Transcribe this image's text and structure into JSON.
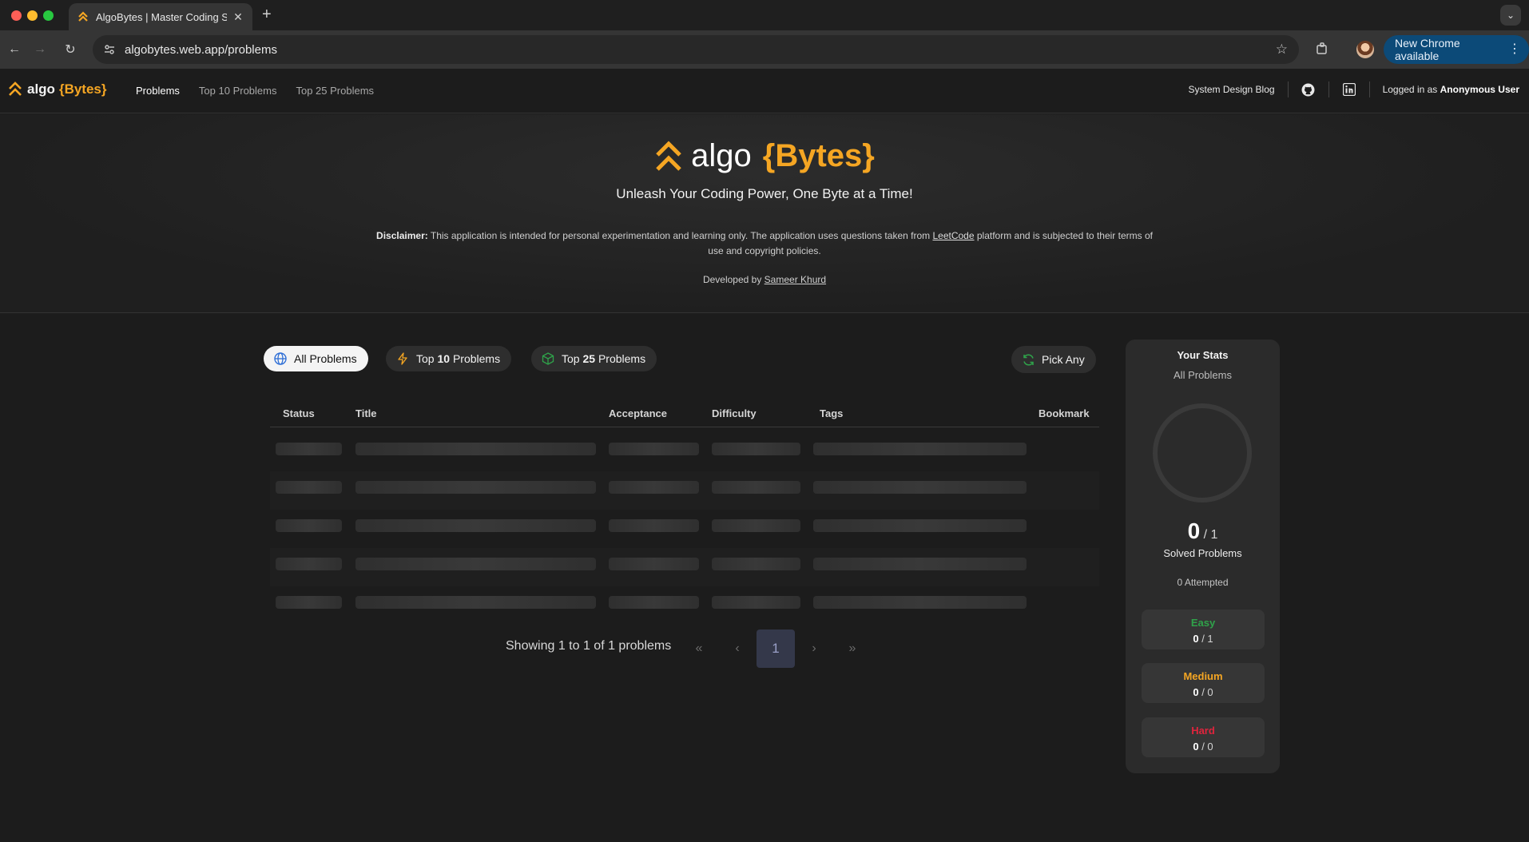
{
  "browser": {
    "tab_title": "AlgoBytes | Master Coding Sk",
    "url": "algobytes.web.app/problems",
    "update_label": "New Chrome available"
  },
  "nav": {
    "brand_text": "algo",
    "brand_accent": "{Bytes}",
    "links": [
      "Problems",
      "Top 10 Problems",
      "Top 25 Problems"
    ],
    "blog": "System Design Blog",
    "login_prefix": "Logged in as",
    "login_user": "Anonymous User"
  },
  "hero": {
    "logo_text": "algo",
    "logo_accent": "{Bytes}",
    "tagline": "Unleash Your Coding Power, One Byte at a Time!",
    "disclaimer_label": "Disclaimer:",
    "disclaimer_pre": "This application is intended for personal experimentation and learning only. The application uses questions taken from",
    "disclaimer_link": "LeetCode",
    "disclaimer_post": "platform and is subjected to their terms of use and copyright policies.",
    "dev_prefix": "Developed by",
    "dev_name": "Sameer Khurd"
  },
  "filters": {
    "all": "All Problems",
    "top10_prefix": "Top",
    "top10_num": "10",
    "top10_suffix": "Problems",
    "top25_prefix": "Top",
    "top25_num": "25",
    "top25_suffix": "Problems",
    "pick": "Pick Any"
  },
  "table": {
    "columns": [
      "Status",
      "Title",
      "Acceptance",
      "Difficulty",
      "Tags",
      "Bookmark"
    ],
    "loading_rows": 5
  },
  "pagination": {
    "showing": "Showing 1 to 1 of 1 problems",
    "current_page": "1",
    "first": "«",
    "prev": "‹",
    "next": "›",
    "last": "»"
  },
  "stats": {
    "title": "Your Stats",
    "subtitle": "All Problems",
    "solved": "0",
    "total": "/ 1",
    "solved_label": "Solved Problems",
    "attempted": "0 Attempted",
    "difficulties": [
      {
        "name": "Easy",
        "solved": "0",
        "total": "/ 1",
        "color": "#2fa34a"
      },
      {
        "name": "Medium",
        "solved": "0",
        "total": "/ 0",
        "color": "#f5a623"
      },
      {
        "name": "Hard",
        "solved": "0",
        "total": "/ 0",
        "color": "#e0243d"
      }
    ]
  },
  "colors": {
    "accent": "#f5a623",
    "background": "#1c1c1c",
    "panel": "#2b2b2b"
  }
}
